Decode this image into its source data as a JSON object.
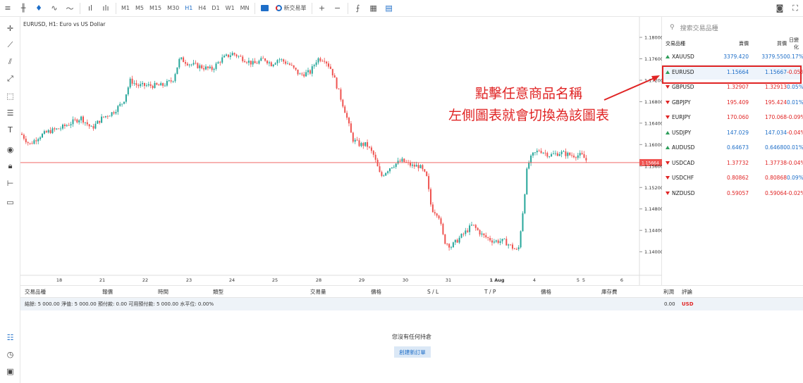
{
  "chart_title": "EURUSD, H1: Euro vs US Dollar",
  "toolbar": {
    "timeframes": [
      "M1",
      "M5",
      "M15",
      "M30",
      "H1",
      "H4",
      "D1",
      "W1",
      "MN"
    ],
    "active_timeframe": "H1",
    "new_trade_label": "新交易單",
    "plus": "+",
    "minus": "−"
  },
  "watchlist": {
    "search_placeholder": "搜索交易品種",
    "headers": {
      "symbol": "交易品種",
      "bid": "賣價",
      "ask": "買價",
      "change": "日變化"
    },
    "rows": [
      {
        "symbol": "XAUUSD",
        "bid": "3379.420",
        "ask": "3379.550",
        "change": "0.17%",
        "dir": "up"
      },
      {
        "symbol": "EURUSD",
        "bid": "1.15664",
        "ask": "1.15667",
        "change": "-0.05%",
        "dir": "up"
      },
      {
        "symbol": "GBPUSD",
        "bid": "1.32907",
        "ask": "1.32913",
        "change": "0.05%",
        "dir": "dn"
      },
      {
        "symbol": "GBPJPY",
        "bid": "195.409",
        "ask": "195.424",
        "change": "0.01%",
        "dir": "dn"
      },
      {
        "symbol": "EURJPY",
        "bid": "170.060",
        "ask": "170.068",
        "change": "-0.09%",
        "dir": "dn"
      },
      {
        "symbol": "USDJPY",
        "bid": "147.029",
        "ask": "147.034",
        "change": "-0.04%",
        "dir": "up"
      },
      {
        "symbol": "AUDUSD",
        "bid": "0.64673",
        "ask": "0.64680",
        "change": "0.01%",
        "dir": "up"
      },
      {
        "symbol": "USDCAD",
        "bid": "1.37732",
        "ask": "1.37738",
        "change": "-0.04%",
        "dir": "dn"
      },
      {
        "symbol": "USDCHF",
        "bid": "0.80862",
        "ask": "0.80868",
        "change": "0.09%",
        "dir": "dn"
      },
      {
        "symbol": "NZDUSD",
        "bid": "0.59057",
        "ask": "0.59064",
        "change": "-0.02%",
        "dir": "dn"
      }
    ],
    "colors": {
      "up": "#1e6ec8",
      "down": "#e02424",
      "selected_bg": "#eef4fb"
    }
  },
  "annotation": {
    "line1": "點擊任意商品名稱",
    "line2": "左側圖表就會切換為該圖表",
    "color": "#e02424"
  },
  "bottom": {
    "headers": {
      "symbol": "交易品種",
      "ticket": "報價",
      "time": "時間",
      "type": "類型",
      "volume": "交易量",
      "price": "價格",
      "sl": "S / L",
      "tp": "T / P",
      "price2": "價格",
      "swap": "庫存費",
      "profit": "利潤",
      "comment": "評論"
    },
    "account": "結餘: 5 000.00   淨值: 5 000.00   預付款: 0.00   可用預付款: 5 000.00   水平位: 0.00%",
    "profit_total": "0.00",
    "currency": "USD",
    "empty_message": "您沒有任何持倉",
    "new_order_button": "創建新訂單"
  },
  "chart_data": {
    "type": "candlestick",
    "title": "EURUSD, H1: Euro vs US Dollar",
    "current_price": "1.15664",
    "y_ticks": [
      "1.18000",
      "1.17600",
      "1.17200",
      "1.16800",
      "1.16400",
      "1.16000",
      "1.15600",
      "1.15200",
      "1.14800",
      "1.14400",
      "1.14000"
    ],
    "ylim": [
      1.1372,
      1.1825
    ],
    "x_ticks": [
      "18",
      "21",
      "22",
      "23",
      "24",
      "25",
      "28",
      "29",
      "30",
      "31",
      "1 Aug",
      "4",
      "5",
      "5",
      "6"
    ],
    "series_path": [
      [
        0,
        1.162
      ],
      [
        12,
        1.16
      ],
      [
        25,
        1.1615
      ],
      [
        40,
        1.1625
      ],
      [
        55,
        1.163
      ],
      [
        70,
        1.164
      ],
      [
        85,
        1.165
      ],
      [
        100,
        1.163
      ],
      [
        115,
        1.165
      ],
      [
        130,
        1.166
      ],
      [
        145,
        1.168
      ],
      [
        155,
        1.172
      ],
      [
        165,
        1.171
      ],
      [
        180,
        1.171
      ],
      [
        200,
        1.171
      ],
      [
        215,
        1.172
      ],
      [
        225,
        1.176
      ],
      [
        240,
        1.175
      ],
      [
        255,
        1.1745
      ],
      [
        270,
        1.174
      ],
      [
        285,
        1.176
      ],
      [
        300,
        1.177
      ],
      [
        315,
        1.176
      ],
      [
        330,
        1.175
      ],
      [
        345,
        1.176
      ],
      [
        355,
        1.175
      ],
      [
        365,
        1.176
      ],
      [
        380,
        1.175
      ],
      [
        395,
        1.173
      ],
      [
        410,
        1.1735
      ],
      [
        420,
        1.176
      ],
      [
        430,
        1.176
      ],
      [
        440,
        1.174
      ],
      [
        450,
        1.17
      ],
      [
        460,
        1.166
      ],
      [
        470,
        1.161
      ],
      [
        480,
        1.16
      ],
      [
        490,
        1.16
      ],
      [
        500,
        1.158
      ],
      [
        510,
        1.154
      ],
      [
        525,
        1.156
      ],
      [
        540,
        1.157
      ],
      [
        555,
        1.156
      ],
      [
        565,
        1.156
      ],
      [
        575,
        1.154
      ],
      [
        582,
        1.148
      ],
      [
        592,
        1.147
      ],
      [
        600,
        1.142
      ],
      [
        610,
        1.141
      ],
      [
        625,
        1.143
      ],
      [
        640,
        1.145
      ],
      [
        655,
        1.143
      ],
      [
        670,
        1.142
      ],
      [
        685,
        1.142
      ],
      [
        695,
        1.141
      ],
      [
        705,
        1.14
      ],
      [
        712,
        1.148
      ],
      [
        718,
        1.156
      ],
      [
        725,
        1.158
      ],
      [
        735,
        1.159
      ],
      [
        750,
        1.158
      ],
      [
        765,
        1.1585
      ],
      [
        780,
        1.158
      ],
      [
        795,
        1.158
      ],
      [
        802,
        1.157
      ]
    ]
  }
}
